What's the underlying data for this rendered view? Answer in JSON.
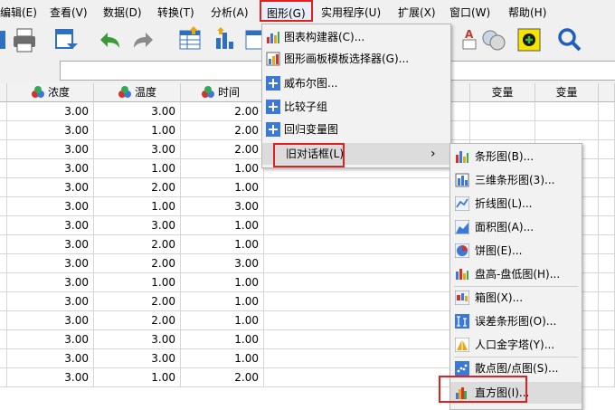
{
  "menubar": {
    "items": [
      {
        "label": "编辑(E)"
      },
      {
        "label": "查看(V)"
      },
      {
        "label": "数据(D)"
      },
      {
        "label": "转换(T)"
      },
      {
        "label": "分析(A)"
      },
      {
        "label": "图形(G)",
        "selected": true
      },
      {
        "label": "实用程序(U)"
      },
      {
        "label": "扩展(X)"
      },
      {
        "label": "窗口(W)"
      },
      {
        "label": "帮助(H)"
      }
    ]
  },
  "toolbar": {
    "icons": [
      "print-icon",
      "recall-dialog-icon",
      "undo-icon",
      "redo-icon",
      "goto-case-icon",
      "goto-variable-icon",
      "insert-cases-icon",
      "value-labels-icon",
      "use-sets-icon",
      "spelling-icon",
      "add-icon",
      "search-icon"
    ]
  },
  "grid": {
    "columns": [
      "浓度",
      "温度",
      "时间",
      "变量",
      "变量"
    ],
    "rows": [
      [
        "3.00",
        "3.00",
        "2.00"
      ],
      [
        "3.00",
        "1.00",
        "2.00"
      ],
      [
        "3.00",
        "3.00",
        "2.00"
      ],
      [
        "3.00",
        "1.00",
        "1.00"
      ],
      [
        "3.00",
        "2.00",
        "1.00"
      ],
      [
        "3.00",
        "1.00",
        "3.00"
      ],
      [
        "3.00",
        "3.00",
        "1.00"
      ],
      [
        "3.00",
        "2.00",
        "1.00"
      ],
      [
        "3.00",
        "2.00",
        "3.00"
      ],
      [
        "3.00",
        "1.00",
        "1.00"
      ],
      [
        "3.00",
        "2.00",
        "1.00"
      ],
      [
        "3.00",
        "2.00",
        "1.00"
      ],
      [
        "3.00",
        "3.00",
        "1.00"
      ],
      [
        "3.00",
        "3.00",
        "1.00"
      ],
      [
        "3.00",
        "1.00",
        "2.00"
      ]
    ]
  },
  "graph_menu": {
    "items": [
      {
        "label": "图表构建器(C)...",
        "icon": "chart-builder-icon"
      },
      {
        "label": "图形画板模板选择器(G)...",
        "icon": "template-chooser-icon"
      },
      {
        "label": "威布尔图...",
        "icon": "weibull-icon"
      },
      {
        "label": "比较子组",
        "icon": "compare-subgroups-icon"
      },
      {
        "label": "回归变量图",
        "icon": "regression-plot-icon"
      },
      {
        "label": "旧对话框(L)",
        "submenu_arrow": "›",
        "highlighted": true
      }
    ]
  },
  "legacy_menu": {
    "items": [
      {
        "label": "条形图(B)...",
        "icon": "bar-chart-icon"
      },
      {
        "label": "三维条形图(3)...",
        "icon": "3d-bar-chart-icon"
      },
      {
        "label": "折线图(L)...",
        "icon": "line-chart-icon"
      },
      {
        "label": "面积图(A)...",
        "icon": "area-chart-icon"
      },
      {
        "label": "饼图(E)...",
        "icon": "pie-chart-icon"
      },
      {
        "label": "盘高-盘低图(H)...",
        "icon": "high-low-chart-icon"
      },
      {
        "label": "箱图(X)...",
        "icon": "boxplot-icon"
      },
      {
        "label": "误差条形图(O)...",
        "icon": "error-bar-icon"
      },
      {
        "label": "人口金字塔(Y)...",
        "icon": "population-pyramid-icon"
      },
      {
        "label": "散点图/点图(S)...",
        "icon": "scatter-icon"
      },
      {
        "label": "直方图(I)...",
        "icon": "histogram-icon",
        "highlighted": true
      }
    ]
  },
  "colors": {
    "highlight_box": "#e01f1f",
    "menu_bg": "#f2f2f2"
  }
}
